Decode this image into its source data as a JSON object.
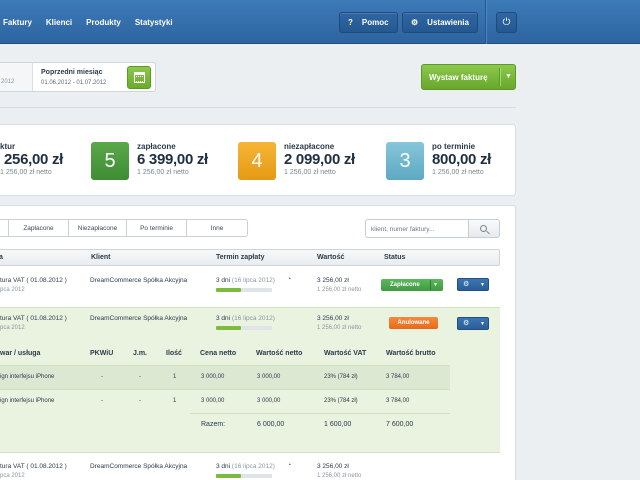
{
  "nav": {
    "items": [
      "Faktury",
      "Klienci",
      "Produkty",
      "Statystyki"
    ],
    "help_label": "Pomoc",
    "settings_label": "Ustawienia"
  },
  "date_filter": {
    "prev_range_fragment": "2012",
    "label": "Poprzedni miesiąc",
    "range": "01.06.2012 - 01.07.2012"
  },
  "issue_button": {
    "label": "Wystaw fakturę"
  },
  "stats": {
    "all": {
      "title_fragment": "ktur",
      "amount": "256,00 zł",
      "net": "1 256,00 zł netto"
    },
    "paid": {
      "count": "5",
      "title": "zapłacone",
      "amount": "6 399,00 zł",
      "net": "1 256,00 zł netto"
    },
    "unpaid": {
      "count": "4",
      "title": "niezapłacone",
      "amount": "2 099,00 zł",
      "net": "1 256,00 zł netto"
    },
    "overdue": {
      "count": "3",
      "title": "po terminie",
      "amount": "800,00 zł",
      "net": "1 256,00 zł netto"
    }
  },
  "tabs": [
    "Zapłacone",
    "Niezapłacone",
    "Po terminie",
    "Inne"
  ],
  "search": {
    "placeholder": "klient, numer faktury..."
  },
  "table": {
    "headers": {
      "invoice_fragment": "a",
      "client": "Klient",
      "due": "Termin zapłaty",
      "value": "Wartość",
      "status": "Status"
    },
    "rows": [
      {
        "title": "tura VAT ( 01.08.2012 )",
        "sub": "pca 2012",
        "client": "DreamCommerce Spółka Akcyjna",
        "days": "3 dni",
        "date": "(16 lipca 2012)",
        "progress": 0.45,
        "value": "3 256,00 zł",
        "net": "1 256,00 zł netto",
        "status": "Zapłacone"
      },
      {
        "title": "tura VAT ( 01.08.2012 )",
        "sub": "pca 2012",
        "client": "DreamCommerce Spółka Akcyjna",
        "days": "3 dni",
        "date": "(16 lipca 2012)",
        "progress": 0.45,
        "value": "3 256,00 zł",
        "net": "1 256,00 zł netto",
        "status": "Anulowane"
      },
      {
        "title": "tura VAT ( 01.08.2012 )",
        "sub": "pca 2012",
        "client": "DreamCommerce Spółka Akcyjna",
        "days": "3 dni",
        "date": "(16 lipca 2012)",
        "progress": 0.45,
        "value": "3 256,00 zł",
        "net": "1 256,00 zł netto"
      }
    ]
  },
  "details": {
    "headers": {
      "item": "war / usługa",
      "pkwiu": "PKWiU",
      "unit": "J.m.",
      "qty": "Ilość",
      "net_price": "Cena netto",
      "net_value": "Wartość netto",
      "vat_value": "Wartość VAT",
      "gross_value": "Wartość brutto"
    },
    "rows": [
      {
        "item": "ign interfejsu iPhone",
        "pkwiu": "-",
        "unit": "-",
        "qty": "1",
        "net_price": "3 000,00",
        "net_value": "3 000,00",
        "vat": "23% (784 zł)",
        "gross": "3 784,00"
      },
      {
        "item": "ign interfejsu iPhone",
        "pkwiu": "-",
        "unit": "-",
        "qty": "1",
        "net_price": "3 000,00",
        "net_value": "3 000,00",
        "vat": "23% (784 zł)",
        "gross": "3 784,00"
      }
    ],
    "summary": {
      "label": "Razem:",
      "net_value": "6 000,00",
      "vat_value": "1 600,00",
      "gross_value": "7 600,00"
    }
  },
  "colors": {
    "nav_blue": "#2d64a0",
    "green": "#6aab2e",
    "paid_green": "#4a9a3c",
    "amber": "#eda31e",
    "light_blue": "#6ab3cc",
    "cancel_orange": "#e96a17"
  }
}
